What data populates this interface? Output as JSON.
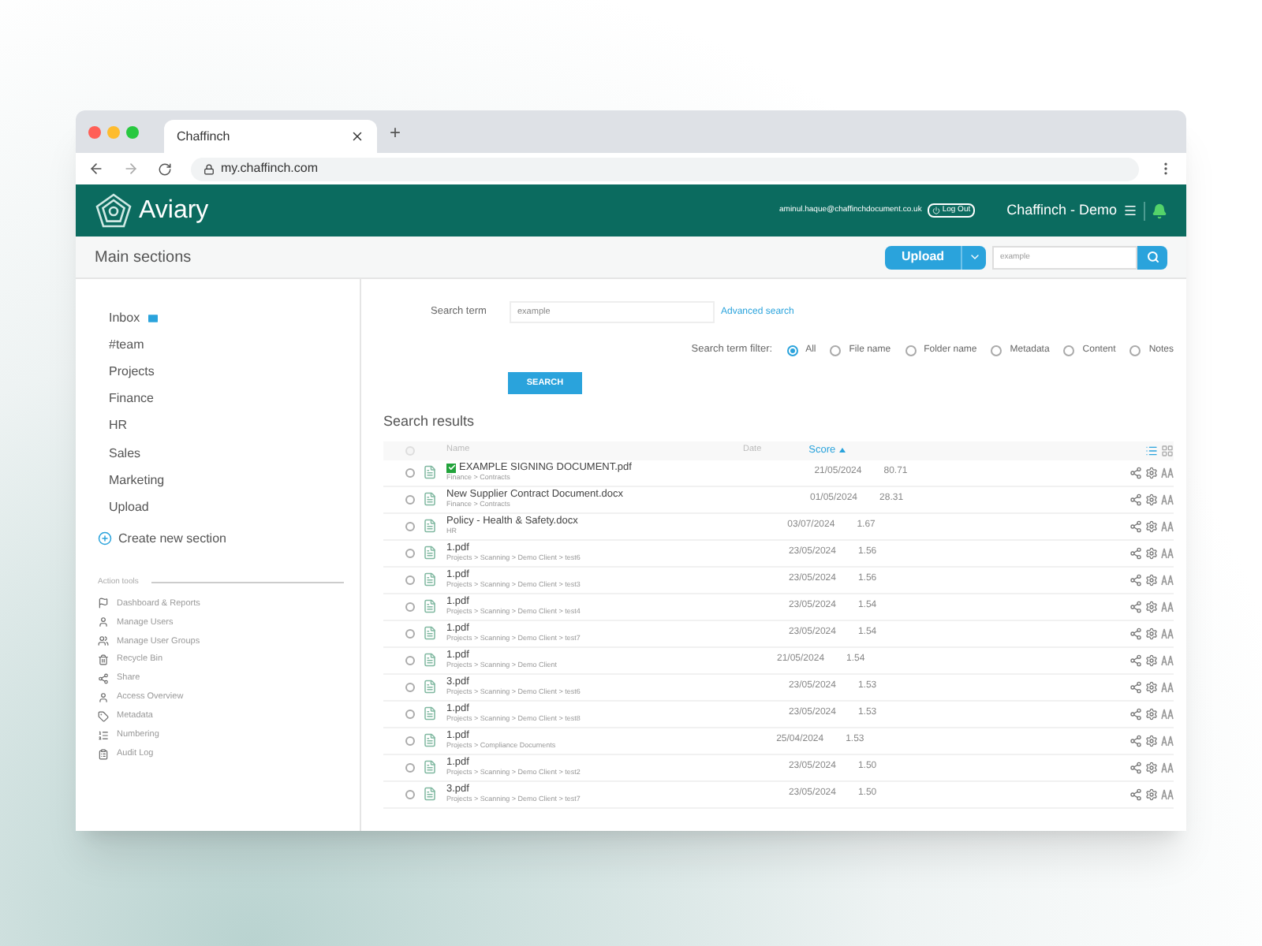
{
  "browser": {
    "tab_title": "Chaffinch",
    "new_tab": "+",
    "url": "my.chaffinch.com"
  },
  "header": {
    "logo": "Aviary",
    "email": "aminul.haque@chaffinchdocument.co.uk",
    "logout": "Log Out",
    "account": "Chaffinch - Demo"
  },
  "subheader": {
    "title": "Main sections",
    "upload": "Upload",
    "search_value": "example"
  },
  "sidebar": {
    "items": [
      {
        "label": "Inbox",
        "kind": "inbox"
      },
      {
        "label": "#team",
        "kind": "plain"
      },
      {
        "label": "Projects",
        "kind": "plain"
      },
      {
        "label": "Finance",
        "kind": "plain"
      },
      {
        "label": "HR",
        "kind": "plain"
      },
      {
        "label": "Sales",
        "kind": "plain"
      },
      {
        "label": "Marketing",
        "kind": "plain"
      },
      {
        "label": "Upload",
        "kind": "plain"
      }
    ],
    "create": "Create new section",
    "tools_title": "Action tools",
    "tools": [
      {
        "label": "Dashboard & Reports",
        "kind": "flag"
      },
      {
        "label": "Manage Users",
        "kind": "user"
      },
      {
        "label": "Manage User Groups",
        "kind": "users"
      },
      {
        "label": "Recycle Bin",
        "kind": "bin"
      },
      {
        "label": "Share",
        "kind": "share"
      },
      {
        "label": "Access Overview",
        "kind": "user"
      },
      {
        "label": "Metadata",
        "kind": "tag"
      },
      {
        "label": "Numbering",
        "kind": "list"
      },
      {
        "label": "Audit Log",
        "kind": "log"
      }
    ]
  },
  "search": {
    "label": "Search term",
    "value": "example",
    "advanced": "Advanced search",
    "filter_label": "Search term filter:",
    "filters": [
      {
        "label": "All",
        "selected": true
      },
      {
        "label": "File name",
        "selected": false
      },
      {
        "label": "Folder name",
        "selected": false
      },
      {
        "label": "Metadata",
        "selected": false
      },
      {
        "label": "Content",
        "selected": false
      },
      {
        "label": "Notes",
        "selected": false
      }
    ],
    "button": "SEARCH"
  },
  "results": {
    "title": "Search results",
    "select_all": {
      "checked": false
    },
    "columns": [
      "Name",
      "Date",
      "Score"
    ],
    "view": [
      {
        "kind": "list",
        "selected": true
      },
      {
        "kind": "grid",
        "selected": false
      }
    ],
    "rows": [
      {
        "name": "EXAMPLE SIGNING DOCUMENT.pdf",
        "path": "Finance > Contracts",
        "date": "21/05/2024",
        "score": "80.71",
        "signed": true,
        "checked": false
      },
      {
        "name": "New Supplier Contract Document.docx",
        "path": "Finance > Contracts",
        "date": "01/05/2024",
        "score": "28.31",
        "signed": false,
        "checked": false
      },
      {
        "name": "Policy - Health & Safety.docx",
        "path": "HR",
        "date": "03/07/2024",
        "score": "1.67",
        "signed": false,
        "checked": false
      },
      {
        "name": "1.pdf",
        "path": "Projects > Scanning > Demo Client > test6",
        "date": "23/05/2024",
        "score": "1.56",
        "signed": false,
        "checked": false
      },
      {
        "name": "1.pdf",
        "path": "Projects > Scanning > Demo Client > test3",
        "date": "23/05/2024",
        "score": "1.56",
        "signed": false,
        "checked": false
      },
      {
        "name": "1.pdf",
        "path": "Projects > Scanning > Demo Client > test4",
        "date": "23/05/2024",
        "score": "1.54",
        "signed": false,
        "checked": false
      },
      {
        "name": "1.pdf",
        "path": "Projects > Scanning > Demo Client > test7",
        "date": "23/05/2024",
        "score": "1.54",
        "signed": false,
        "checked": false
      },
      {
        "name": "1.pdf",
        "path": "Projects > Scanning > Demo Client",
        "date": "21/05/2024",
        "score": "1.54",
        "signed": false,
        "checked": false
      },
      {
        "name": "3.pdf",
        "path": "Projects > Scanning > Demo Client > test6",
        "date": "23/05/2024",
        "score": "1.53",
        "signed": false,
        "checked": false
      },
      {
        "name": "1.pdf",
        "path": "Projects > Scanning > Demo Client > test8",
        "date": "23/05/2024",
        "score": "1.53",
        "signed": false,
        "checked": false
      },
      {
        "name": "1.pdf",
        "path": "Projects > Compliance Documents",
        "date": "25/04/2024",
        "score": "1.53",
        "signed": false,
        "checked": false
      },
      {
        "name": "1.pdf",
        "path": "Projects > Scanning > Demo Client > test2",
        "date": "23/05/2024",
        "score": "1.50",
        "signed": false,
        "checked": false
      },
      {
        "name": "3.pdf",
        "path": "Projects > Scanning > Demo Client > test7",
        "date": "23/05/2024",
        "score": "1.50",
        "signed": false,
        "checked": false
      }
    ]
  }
}
